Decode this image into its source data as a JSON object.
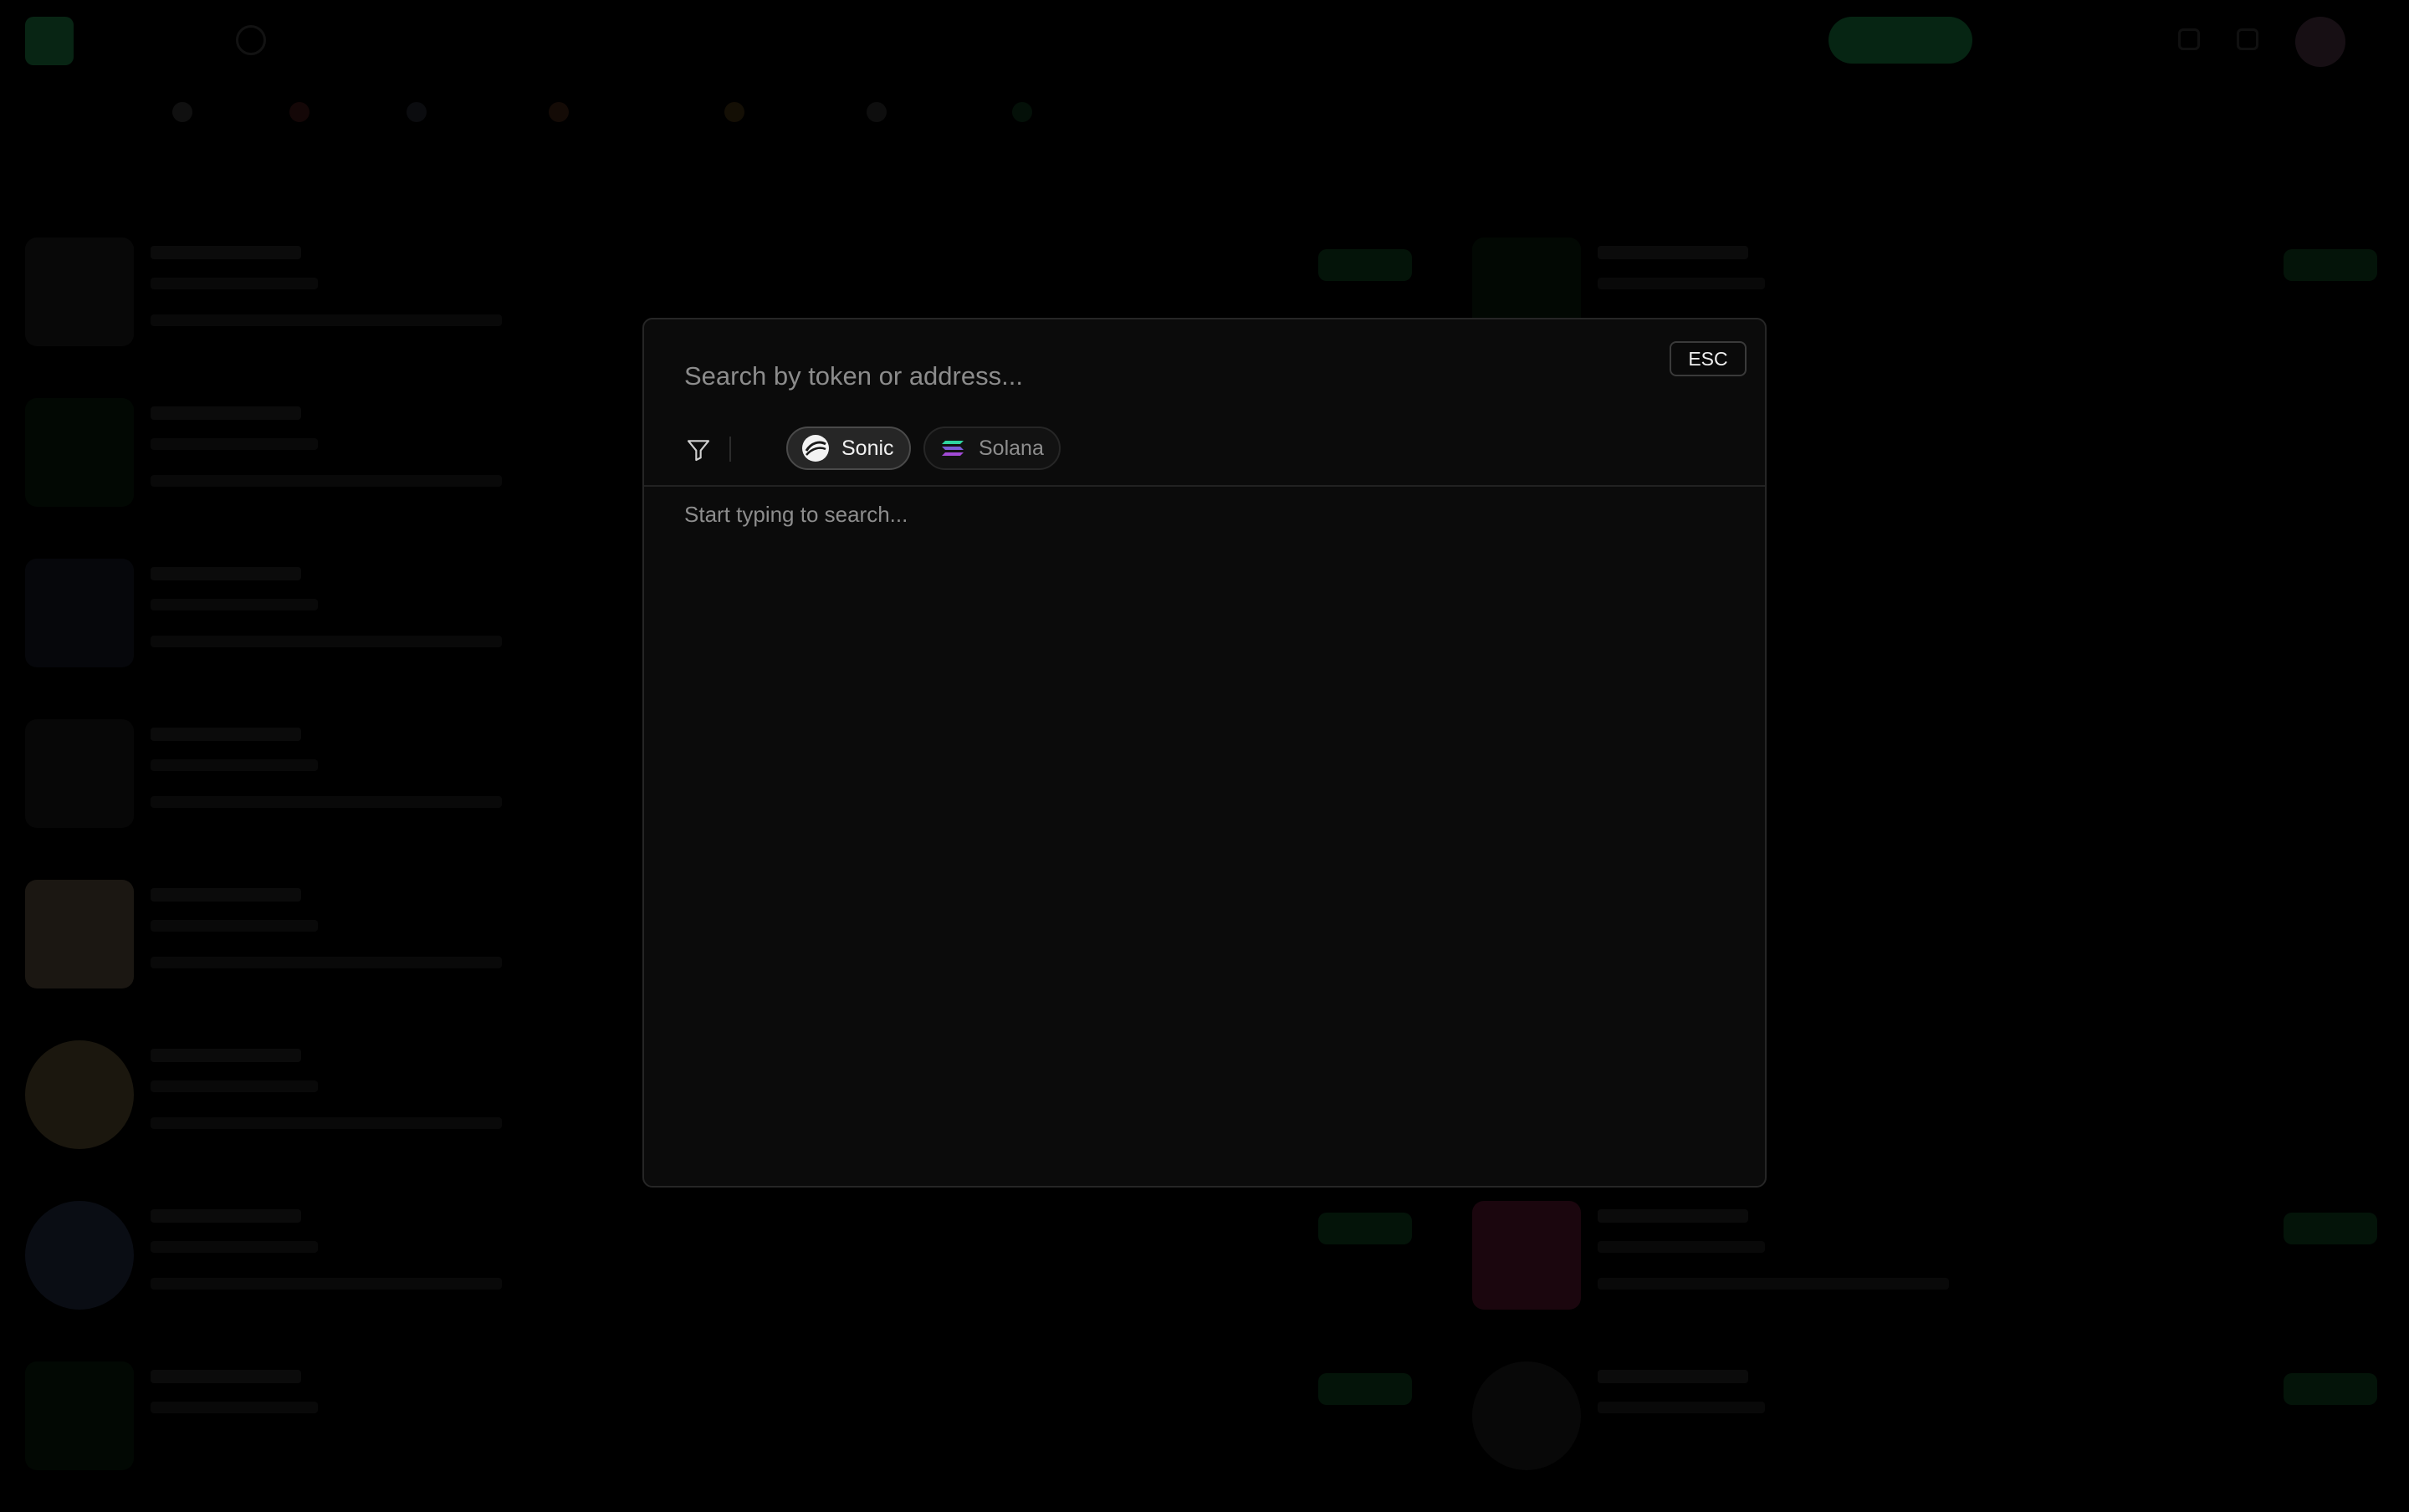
{
  "modal": {
    "search_placeholder": "Search by token or address...",
    "esc_label": "ESC",
    "chains": [
      {
        "label": "Sonic",
        "selected": true
      },
      {
        "label": "Solana",
        "selected": false
      }
    ],
    "empty_hint": "Start typing to search..."
  },
  "colors": {
    "accent_green": "#0b3a1d",
    "modal_bg": "#0b0b0b",
    "chip_selected_bg": "#262626"
  }
}
